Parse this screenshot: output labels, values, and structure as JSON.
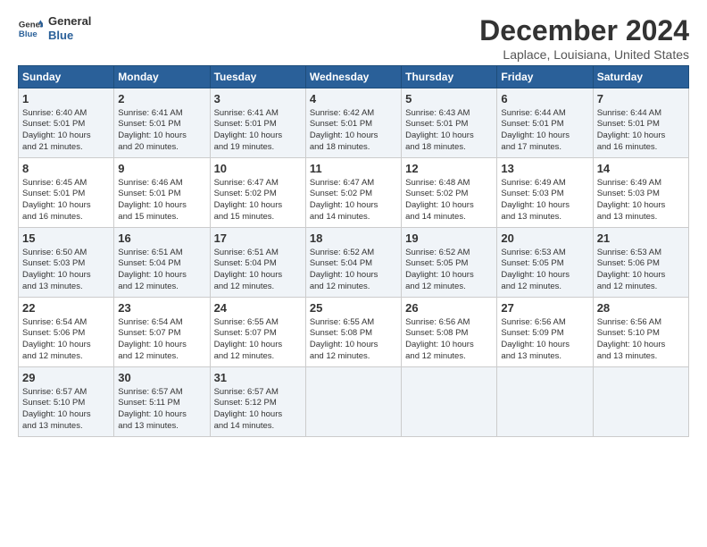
{
  "header": {
    "logo_line1": "General",
    "logo_line2": "Blue",
    "title": "December 2024",
    "location": "Laplace, Louisiana, United States"
  },
  "columns": [
    "Sunday",
    "Monday",
    "Tuesday",
    "Wednesday",
    "Thursday",
    "Friday",
    "Saturday"
  ],
  "rows": [
    [
      {
        "day": "1",
        "lines": [
          "Sunrise: 6:40 AM",
          "Sunset: 5:01 PM",
          "Daylight: 10 hours",
          "and 21 minutes."
        ]
      },
      {
        "day": "2",
        "lines": [
          "Sunrise: 6:41 AM",
          "Sunset: 5:01 PM",
          "Daylight: 10 hours",
          "and 20 minutes."
        ]
      },
      {
        "day": "3",
        "lines": [
          "Sunrise: 6:41 AM",
          "Sunset: 5:01 PM",
          "Daylight: 10 hours",
          "and 19 minutes."
        ]
      },
      {
        "day": "4",
        "lines": [
          "Sunrise: 6:42 AM",
          "Sunset: 5:01 PM",
          "Daylight: 10 hours",
          "and 18 minutes."
        ]
      },
      {
        "day": "5",
        "lines": [
          "Sunrise: 6:43 AM",
          "Sunset: 5:01 PM",
          "Daylight: 10 hours",
          "and 18 minutes."
        ]
      },
      {
        "day": "6",
        "lines": [
          "Sunrise: 6:44 AM",
          "Sunset: 5:01 PM",
          "Daylight: 10 hours",
          "and 17 minutes."
        ]
      },
      {
        "day": "7",
        "lines": [
          "Sunrise: 6:44 AM",
          "Sunset: 5:01 PM",
          "Daylight: 10 hours",
          "and 16 minutes."
        ]
      }
    ],
    [
      {
        "day": "8",
        "lines": [
          "Sunrise: 6:45 AM",
          "Sunset: 5:01 PM",
          "Daylight: 10 hours",
          "and 16 minutes."
        ]
      },
      {
        "day": "9",
        "lines": [
          "Sunrise: 6:46 AM",
          "Sunset: 5:01 PM",
          "Daylight: 10 hours",
          "and 15 minutes."
        ]
      },
      {
        "day": "10",
        "lines": [
          "Sunrise: 6:47 AM",
          "Sunset: 5:02 PM",
          "Daylight: 10 hours",
          "and 15 minutes."
        ]
      },
      {
        "day": "11",
        "lines": [
          "Sunrise: 6:47 AM",
          "Sunset: 5:02 PM",
          "Daylight: 10 hours",
          "and 14 minutes."
        ]
      },
      {
        "day": "12",
        "lines": [
          "Sunrise: 6:48 AM",
          "Sunset: 5:02 PM",
          "Daylight: 10 hours",
          "and 14 minutes."
        ]
      },
      {
        "day": "13",
        "lines": [
          "Sunrise: 6:49 AM",
          "Sunset: 5:03 PM",
          "Daylight: 10 hours",
          "and 13 minutes."
        ]
      },
      {
        "day": "14",
        "lines": [
          "Sunrise: 6:49 AM",
          "Sunset: 5:03 PM",
          "Daylight: 10 hours",
          "and 13 minutes."
        ]
      }
    ],
    [
      {
        "day": "15",
        "lines": [
          "Sunrise: 6:50 AM",
          "Sunset: 5:03 PM",
          "Daylight: 10 hours",
          "and 13 minutes."
        ]
      },
      {
        "day": "16",
        "lines": [
          "Sunrise: 6:51 AM",
          "Sunset: 5:04 PM",
          "Daylight: 10 hours",
          "and 12 minutes."
        ]
      },
      {
        "day": "17",
        "lines": [
          "Sunrise: 6:51 AM",
          "Sunset: 5:04 PM",
          "Daylight: 10 hours",
          "and 12 minutes."
        ]
      },
      {
        "day": "18",
        "lines": [
          "Sunrise: 6:52 AM",
          "Sunset: 5:04 PM",
          "Daylight: 10 hours",
          "and 12 minutes."
        ]
      },
      {
        "day": "19",
        "lines": [
          "Sunrise: 6:52 AM",
          "Sunset: 5:05 PM",
          "Daylight: 10 hours",
          "and 12 minutes."
        ]
      },
      {
        "day": "20",
        "lines": [
          "Sunrise: 6:53 AM",
          "Sunset: 5:05 PM",
          "Daylight: 10 hours",
          "and 12 minutes."
        ]
      },
      {
        "day": "21",
        "lines": [
          "Sunrise: 6:53 AM",
          "Sunset: 5:06 PM",
          "Daylight: 10 hours",
          "and 12 minutes."
        ]
      }
    ],
    [
      {
        "day": "22",
        "lines": [
          "Sunrise: 6:54 AM",
          "Sunset: 5:06 PM",
          "Daylight: 10 hours",
          "and 12 minutes."
        ]
      },
      {
        "day": "23",
        "lines": [
          "Sunrise: 6:54 AM",
          "Sunset: 5:07 PM",
          "Daylight: 10 hours",
          "and 12 minutes."
        ]
      },
      {
        "day": "24",
        "lines": [
          "Sunrise: 6:55 AM",
          "Sunset: 5:07 PM",
          "Daylight: 10 hours",
          "and 12 minutes."
        ]
      },
      {
        "day": "25",
        "lines": [
          "Sunrise: 6:55 AM",
          "Sunset: 5:08 PM",
          "Daylight: 10 hours",
          "and 12 minutes."
        ]
      },
      {
        "day": "26",
        "lines": [
          "Sunrise: 6:56 AM",
          "Sunset: 5:08 PM",
          "Daylight: 10 hours",
          "and 12 minutes."
        ]
      },
      {
        "day": "27",
        "lines": [
          "Sunrise: 6:56 AM",
          "Sunset: 5:09 PM",
          "Daylight: 10 hours",
          "and 13 minutes."
        ]
      },
      {
        "day": "28",
        "lines": [
          "Sunrise: 6:56 AM",
          "Sunset: 5:10 PM",
          "Daylight: 10 hours",
          "and 13 minutes."
        ]
      }
    ],
    [
      {
        "day": "29",
        "lines": [
          "Sunrise: 6:57 AM",
          "Sunset: 5:10 PM",
          "Daylight: 10 hours",
          "and 13 minutes."
        ]
      },
      {
        "day": "30",
        "lines": [
          "Sunrise: 6:57 AM",
          "Sunset: 5:11 PM",
          "Daylight: 10 hours",
          "and 13 minutes."
        ]
      },
      {
        "day": "31",
        "lines": [
          "Sunrise: 6:57 AM",
          "Sunset: 5:12 PM",
          "Daylight: 10 hours",
          "and 14 minutes."
        ]
      },
      null,
      null,
      null,
      null
    ]
  ]
}
